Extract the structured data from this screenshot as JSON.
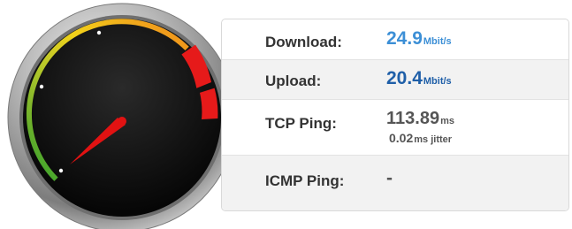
{
  "gauge": {
    "name": "speed-gauge",
    "level_fraction": 0.34,
    "colors": {
      "bezel": "#9a9a9a",
      "face": "#0d0d0d",
      "needle": "#e11212",
      "scale_green": "#3aa52b",
      "scale_yellow": "#f2d21a",
      "scale_orange": "#f08a1d",
      "redzone": "#e61a1a"
    }
  },
  "results": {
    "download": {
      "label": "Download:",
      "value": "24.9",
      "unit": "Mbit/s",
      "color": "#3c8fd6"
    },
    "upload": {
      "label": "Upload:",
      "value": "20.4",
      "unit": "Mbit/s",
      "color": "#1f5fa8"
    },
    "tcp_ping": {
      "label": "TCP Ping:",
      "value": "113.89",
      "unit": "ms",
      "jitter_value": "0.02",
      "jitter_unit": "ms jitter",
      "color": "#555555"
    },
    "icmp_ping": {
      "label": "ICMP Ping:",
      "value": "-",
      "color": "#555555"
    }
  }
}
